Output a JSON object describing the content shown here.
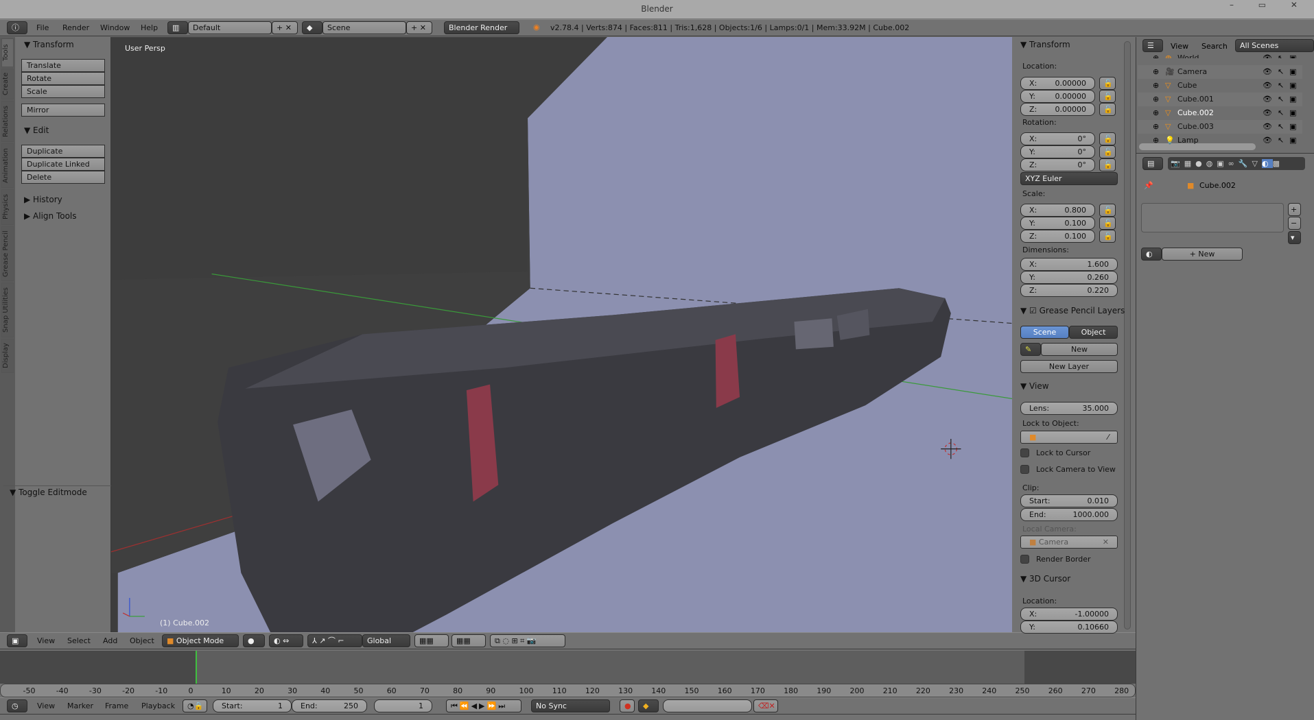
{
  "window": {
    "title": "Blender",
    "controls": "– ▭ ✕"
  },
  "info_header": {
    "menus": [
      "File",
      "Render",
      "Window",
      "Help"
    ],
    "layout": "Default",
    "scene": "Scene",
    "engine": "Blender Render",
    "stats": "v2.78.4 | Verts:874 | Faces:811 | Tris:1,628 | Objects:1/6 | Lamps:0/1 | Mem:33.92M | Cube.002"
  },
  "tool_tabs": [
    "Tools",
    "Create",
    "Relations",
    "Animation",
    "Physics",
    "Grease Pencil",
    "Snap Utilities",
    "Display"
  ],
  "tool_shelf": {
    "transform": "Transform",
    "translate": "Translate",
    "rotate": "Rotate",
    "scale": "Scale",
    "mirror": "Mirror",
    "edit": "Edit",
    "duplicate": "Duplicate",
    "duplicate_linked": "Duplicate Linked",
    "delete": "Delete",
    "history": "History",
    "align_tools": "Align Tools",
    "toggle_editmode": "Toggle Editmode"
  },
  "viewport": {
    "view_label": "User Persp",
    "object_label": "(1) Cube.002",
    "colors": {
      "background": "#3d3d3d",
      "plane": "#8c90b0",
      "object": "#3a3a40",
      "accent_red": "#8a3a4a"
    }
  },
  "npanel": {
    "transform": "Transform",
    "location": "Location:",
    "loc": [
      [
        "X:",
        "0.00000"
      ],
      [
        "Y:",
        "0.00000"
      ],
      [
        "Z:",
        "0.00000"
      ]
    ],
    "rotation": "Rotation:",
    "rot": [
      [
        "X:",
        "0°"
      ],
      [
        "Y:",
        "0°"
      ],
      [
        "Z:",
        "0°"
      ]
    ],
    "rotation_mode": "XYZ Euler",
    "scale_label": "Scale:",
    "scale": [
      [
        "X:",
        "0.800"
      ],
      [
        "Y:",
        "0.100"
      ],
      [
        "Z:",
        "0.100"
      ]
    ],
    "dimensions": "Dimensions:",
    "dim": [
      [
        "X:",
        "1.600"
      ],
      [
        "Y:",
        "0.260"
      ],
      [
        "Z:",
        "0.220"
      ]
    ],
    "grease_pencil": "Grease Pencil Layers",
    "gp_scene": "Scene",
    "gp_object": "Object",
    "gp_new": "New",
    "gp_new_layer": "New Layer",
    "view": "View",
    "lens_label": "Lens:",
    "lens": "35.000",
    "lock_to_object": "Lock to Object:",
    "lock_to_cursor": "Lock to Cursor",
    "lock_camera": "Lock Camera to View",
    "clip": "Clip:",
    "clip_start_label": "Start:",
    "clip_start": "0.010",
    "clip_end_label": "End:",
    "clip_end": "1000.000",
    "local_camera": "Local Camera:",
    "camera": "Camera",
    "render_border": "Render Border",
    "cursor": "3D Cursor",
    "cursor_location": "Location:",
    "cursor_loc": [
      [
        "X:",
        "-1.00000"
      ],
      [
        "Y:",
        "0.10660"
      ]
    ]
  },
  "outliner": {
    "menus": [
      "View",
      "Search"
    ],
    "filter": "All Scenes",
    "items": [
      "World",
      "Camera",
      "Cube",
      "Cube.001",
      "Cube.002",
      "Cube.003",
      "Lamp"
    ],
    "selected": "Cube.002"
  },
  "properties": {
    "breadcrumb": "Cube.002",
    "new": "New"
  },
  "view3d_header": {
    "menus": [
      "View",
      "Select",
      "Add",
      "Object"
    ],
    "mode": "Object Mode",
    "orientation": "Global"
  },
  "timeline": {
    "ticks": [
      -50,
      -40,
      -30,
      -20,
      -10,
      0,
      10,
      20,
      30,
      40,
      50,
      60,
      70,
      80,
      90,
      100,
      110,
      120,
      130,
      140,
      150,
      160,
      170,
      180,
      190,
      200,
      210,
      220,
      230,
      240,
      250,
      260,
      270,
      280
    ],
    "current_frame": 1,
    "range_start": 1,
    "range_end": 250
  },
  "timeline_header": {
    "menus": [
      "View",
      "Marker",
      "Frame",
      "Playback"
    ],
    "start_label": "Start:",
    "start": "1",
    "end_label": "End:",
    "end": "250",
    "frame": "1",
    "sync": "No Sync"
  }
}
